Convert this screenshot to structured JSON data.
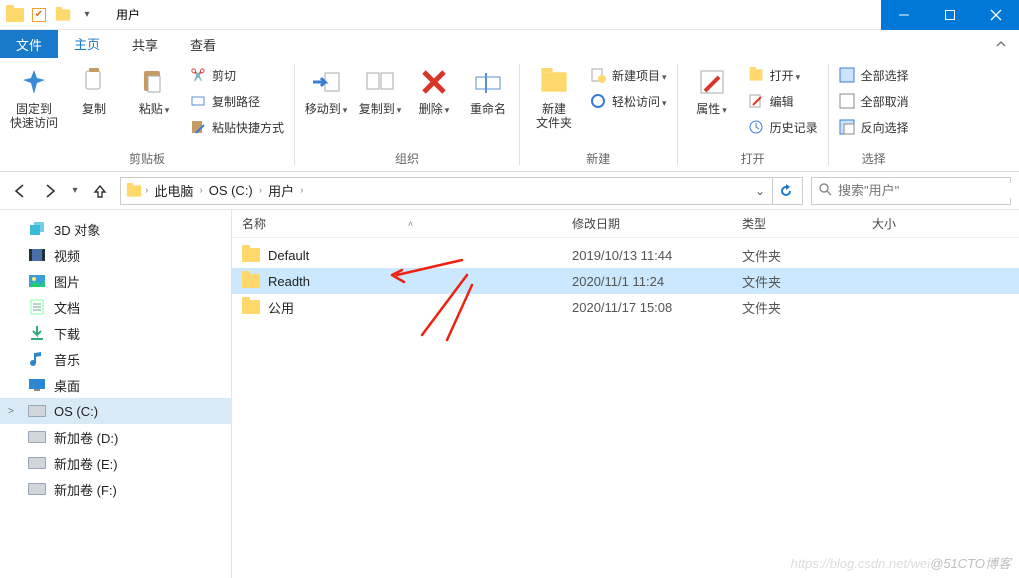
{
  "window": {
    "title": "用户"
  },
  "tabs": {
    "file": "文件",
    "home": "主页",
    "share": "共享",
    "view": "查看"
  },
  "ribbon": {
    "clipboard": {
      "pin": "固定到\n快速访问",
      "copy": "复制",
      "paste": "粘贴",
      "cut": "剪切",
      "copypath": "复制路径",
      "pasteshortcut": "粘贴快捷方式",
      "group": "剪贴板"
    },
    "organize": {
      "moveto": "移动到",
      "copyto": "复制到",
      "delete": "删除",
      "rename": "重命名",
      "group": "组织"
    },
    "new": {
      "newfolder": "新建\n文件夹",
      "newitem": "新建项目",
      "easyaccess": "轻松访问",
      "group": "新建"
    },
    "open": {
      "properties": "属性",
      "open": "打开",
      "edit": "编辑",
      "history": "历史记录",
      "group": "打开"
    },
    "select": {
      "selectall": "全部选择",
      "selectnone": "全部取消",
      "invert": "反向选择",
      "group": "选择"
    }
  },
  "breadcrumbs": {
    "items": [
      "此电脑",
      "OS (C:)",
      "用户"
    ]
  },
  "search": {
    "placeholder": "搜索\"用户\""
  },
  "navpane": {
    "items": [
      {
        "label": "3D 对象",
        "icon": "3d"
      },
      {
        "label": "视频",
        "icon": "video"
      },
      {
        "label": "图片",
        "icon": "pictures"
      },
      {
        "label": "文档",
        "icon": "documents"
      },
      {
        "label": "下载",
        "icon": "downloads"
      },
      {
        "label": "音乐",
        "icon": "music"
      },
      {
        "label": "桌面",
        "icon": "desktop"
      },
      {
        "label": "OS (C:)",
        "icon": "drive",
        "selected": true,
        "expand": true
      },
      {
        "label": "新加卷 (D:)",
        "icon": "drive"
      },
      {
        "label": "新加卷 (E:)",
        "icon": "drive"
      },
      {
        "label": "新加卷 (F:)",
        "icon": "drive"
      }
    ]
  },
  "columns": {
    "name": "名称",
    "date": "修改日期",
    "type": "类型",
    "size": "大小"
  },
  "rows": [
    {
      "name": "Default",
      "date": "2019/10/13 11:44",
      "type": "文件夹",
      "size": ""
    },
    {
      "name": "Readth",
      "date": "2020/11/1 11:24",
      "type": "文件夹",
      "size": "",
      "selected": true
    },
    {
      "name": "公用",
      "date": "2020/11/17 15:08",
      "type": "文件夹",
      "size": ""
    }
  ],
  "watermark": {
    "faint": "https://blog.csdn.net/wei",
    "bold": "@51CTO博客"
  }
}
